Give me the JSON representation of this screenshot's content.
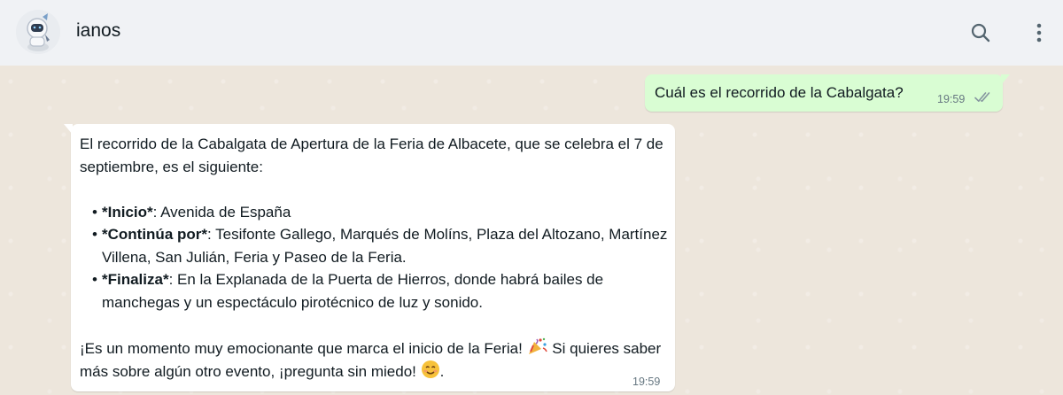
{
  "header": {
    "contact_name": "ianos",
    "avatar_icon": "robot-astronaut-avatar",
    "search_icon": "search-icon",
    "menu_icon": "kebab-menu-icon"
  },
  "colors": {
    "header_bg": "#f0f2f5",
    "chat_bg": "#ede6dc",
    "outgoing_bubble": "#d9fdd3",
    "incoming_bubble": "#ffffff",
    "tick_color": "#8696a0"
  },
  "messages": {
    "outgoing": {
      "text": "Cuál es el recorrido de la Cabalgata?",
      "time": "19:59",
      "status_icon": "double-check-icon"
    },
    "incoming": {
      "intro": "El recorrido de la Cabalgata de Apertura de la Feria de Albacete, que se celebra el 7 de septiembre, es el siguiente:",
      "items": [
        {
          "label": "*Inicio*",
          "text": ": Avenida de España"
        },
        {
          "label": "*Continúa por*",
          "text": ": Tesifonte Gallego, Marqués de Molíns, Plaza del Altozano, Martínez Villena, San Julián, Feria y Paseo de la Feria."
        },
        {
          "label": "*Finaliza*",
          "text": ": En la Explanada de la Puerta de Hierros, donde habrá bailes de manchegas y un espectáculo pirotécnico de luz y sonido."
        }
      ],
      "closing_part1": "¡Es un momento muy emocionante que marca el inicio de la Feria! ",
      "closing_emoji1": "party-popper-emoji",
      "closing_part2": " Si quieres saber más sobre algún otro evento, ¡pregunta sin miedo! ",
      "closing_emoji2": "smiling-face-emoji",
      "closing_part3": ".",
      "time": "19:59"
    }
  }
}
